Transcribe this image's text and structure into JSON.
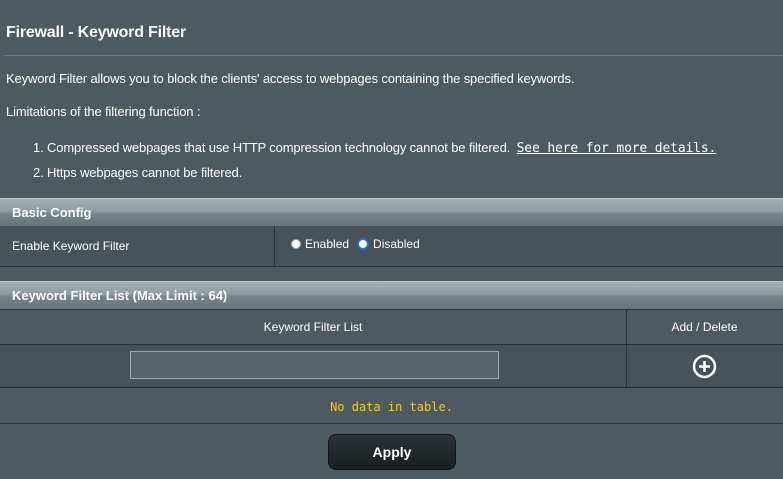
{
  "page": {
    "title": "Firewall - Keyword Filter",
    "description": "Keyword Filter allows you to block the clients' access to webpages containing the specified keywords.",
    "limitations_heading": "Limitations of the filtering function :",
    "limitations": [
      {
        "number": "1.",
        "text": "Compressed webpages that use HTTP compression technology cannot be filtered.",
        "link": "See here for more details."
      },
      {
        "number": "2.",
        "text": "Https webpages cannot be filtered."
      }
    ]
  },
  "basic_config": {
    "header": "Basic Config",
    "enable_label": "Enable Keyword Filter",
    "options": [
      {
        "label": "Enabled",
        "selected": false
      },
      {
        "label": "Disabled",
        "selected": true
      }
    ]
  },
  "keyword_list": {
    "header": "Keyword Filter List (Max Limit : 64)",
    "columns": [
      "Keyword Filter List",
      "Add / Delete"
    ],
    "input_value": "",
    "empty_message": "No data in table."
  },
  "actions": {
    "apply_label": "Apply"
  },
  "icons": {
    "add": "plus-circle-icon"
  },
  "colors": {
    "background": "#4d5a5f",
    "empty_message": "#ffcc00",
    "radio_selected": "#1d6fd6"
  }
}
